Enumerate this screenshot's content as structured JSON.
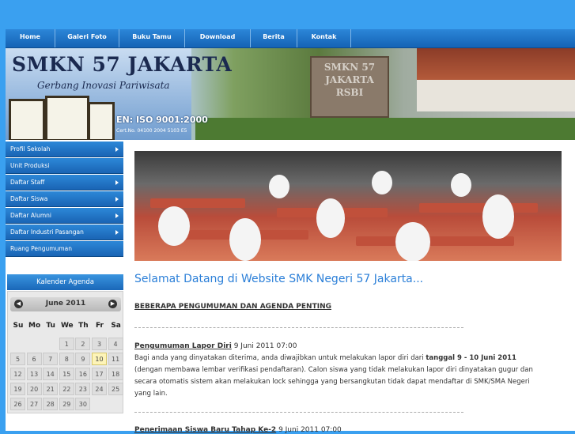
{
  "nav": {
    "items": [
      "Home",
      "Galeri Foto",
      "Buku Tamu",
      "Download",
      "Berita",
      "Kontak"
    ]
  },
  "banner": {
    "title": "SMKN 57 JAKARTA",
    "tagline": "Gerbang Inovasi Pariwisata",
    "iso": "EN: ISO 9001:2000",
    "cert_no": "Cert.No. 04100 2004 5103 E5",
    "sign_text": "SMKN 57 JAKARTA RSBI"
  },
  "sidebar": {
    "items": [
      {
        "label": "Profil Sekolah",
        "has_submenu": true
      },
      {
        "label": "Unit Produksi",
        "has_submenu": false
      },
      {
        "label": "Daftar Staff",
        "has_submenu": true
      },
      {
        "label": "Daftar Siswa",
        "has_submenu": true
      },
      {
        "label": "Daftar Alumni",
        "has_submenu": true
      },
      {
        "label": "Daftar Industri Pasangan",
        "has_submenu": true
      },
      {
        "label": "Ruang Pengumuman",
        "has_submenu": false
      }
    ]
  },
  "calendar": {
    "heading": "Kalender Agenda",
    "month": "June 2011",
    "prev_icon": "◀",
    "next_icon": "▶",
    "days_of_week": [
      "Su",
      "Mo",
      "Tu",
      "We",
      "Th",
      "Fr",
      "Sa"
    ],
    "weeks": [
      [
        "",
        "",
        "",
        "1",
        "2",
        "3",
        "4"
      ],
      [
        "5",
        "6",
        "7",
        "8",
        "9",
        "10",
        "11"
      ],
      [
        "12",
        "13",
        "14",
        "15",
        "16",
        "17",
        "18"
      ],
      [
        "19",
        "20",
        "21",
        "22",
        "23",
        "24",
        "25"
      ],
      [
        "26",
        "27",
        "28",
        "29",
        "30",
        "",
        ""
      ]
    ],
    "today": "10"
  },
  "main": {
    "welcome": "Selamat Datang di Website SMK Negeri 57 Jakarta...",
    "subheading": "BEBERAPA PENGUMUMAN DAN AGENDA PENTING",
    "announcements": [
      {
        "title": "Pengumuman Lapor Diri",
        "date": "9 Juni 2011 07:00",
        "body_pre": "Bagi anda yang dinyatakan diterima, anda diwajibkan untuk melakukan lapor diri dari ",
        "body_bold": "tanggal 9 - 10 Juni 2011",
        "body_post": " (dengan membawa lembar verifikasi pendaftaran). Calon siswa yang tidak melakukan lapor diri dinyatakan gugur dan secara otomatis sistem akan melakukan lock sehingga yang bersangkutan tidak dapat mendaftar di SMK/SMA Negeri yang lain."
      },
      {
        "title": "Penerimaan Siswa Baru Tahap Ke-2",
        "date": "9 Juni 2011 07:00"
      }
    ]
  },
  "colors": {
    "background": "#3aa0f0",
    "nav": "#1a6cc0",
    "welcome_text": "#2b7fd8",
    "today_highlight": "#fdf4b8"
  }
}
